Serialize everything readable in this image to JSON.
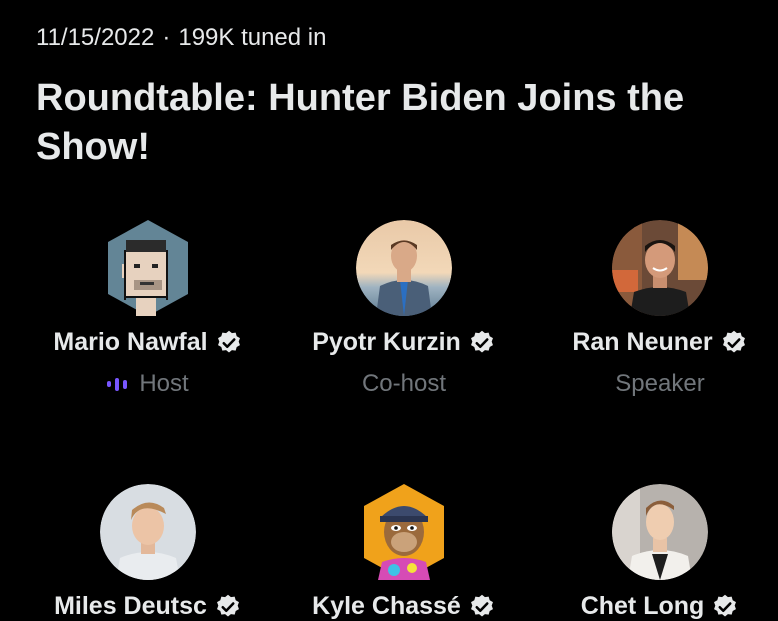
{
  "space": {
    "date": "11/15/2022",
    "separator": "·",
    "tuned_in": "199K tuned in",
    "title": "Roundtable: Hunter Biden Joins the Show!"
  },
  "participants": [
    {
      "name": "Mario Nawfal",
      "role": "Host",
      "avatar": "pixel-punk-avatar",
      "verified": true,
      "speaking_indicator": "audio-wave-icon"
    },
    {
      "name": "Pyotr Kurzin",
      "role": "Co-host",
      "avatar": "photo-avatar",
      "verified": true
    },
    {
      "name": "Ran Neuner",
      "role": "Speaker",
      "avatar": "photo-avatar",
      "verified": true
    },
    {
      "name": "Miles Deutsc",
      "role": "",
      "avatar": "photo-avatar",
      "verified": true
    },
    {
      "name": "Kyle Chassé",
      "role": "",
      "avatar": "ape-nft-avatar",
      "verified": true
    },
    {
      "name": "Chet Long",
      "role": "",
      "avatar": "photo-avatar",
      "verified": true
    }
  ],
  "colors": {
    "background": "#000000",
    "text_primary": "#e7e9ea",
    "text_secondary": "#71767b",
    "accent_purple": "#7856ff",
    "hex_avatar_blue": "#638596",
    "ape_orange": "#f0a21b"
  }
}
